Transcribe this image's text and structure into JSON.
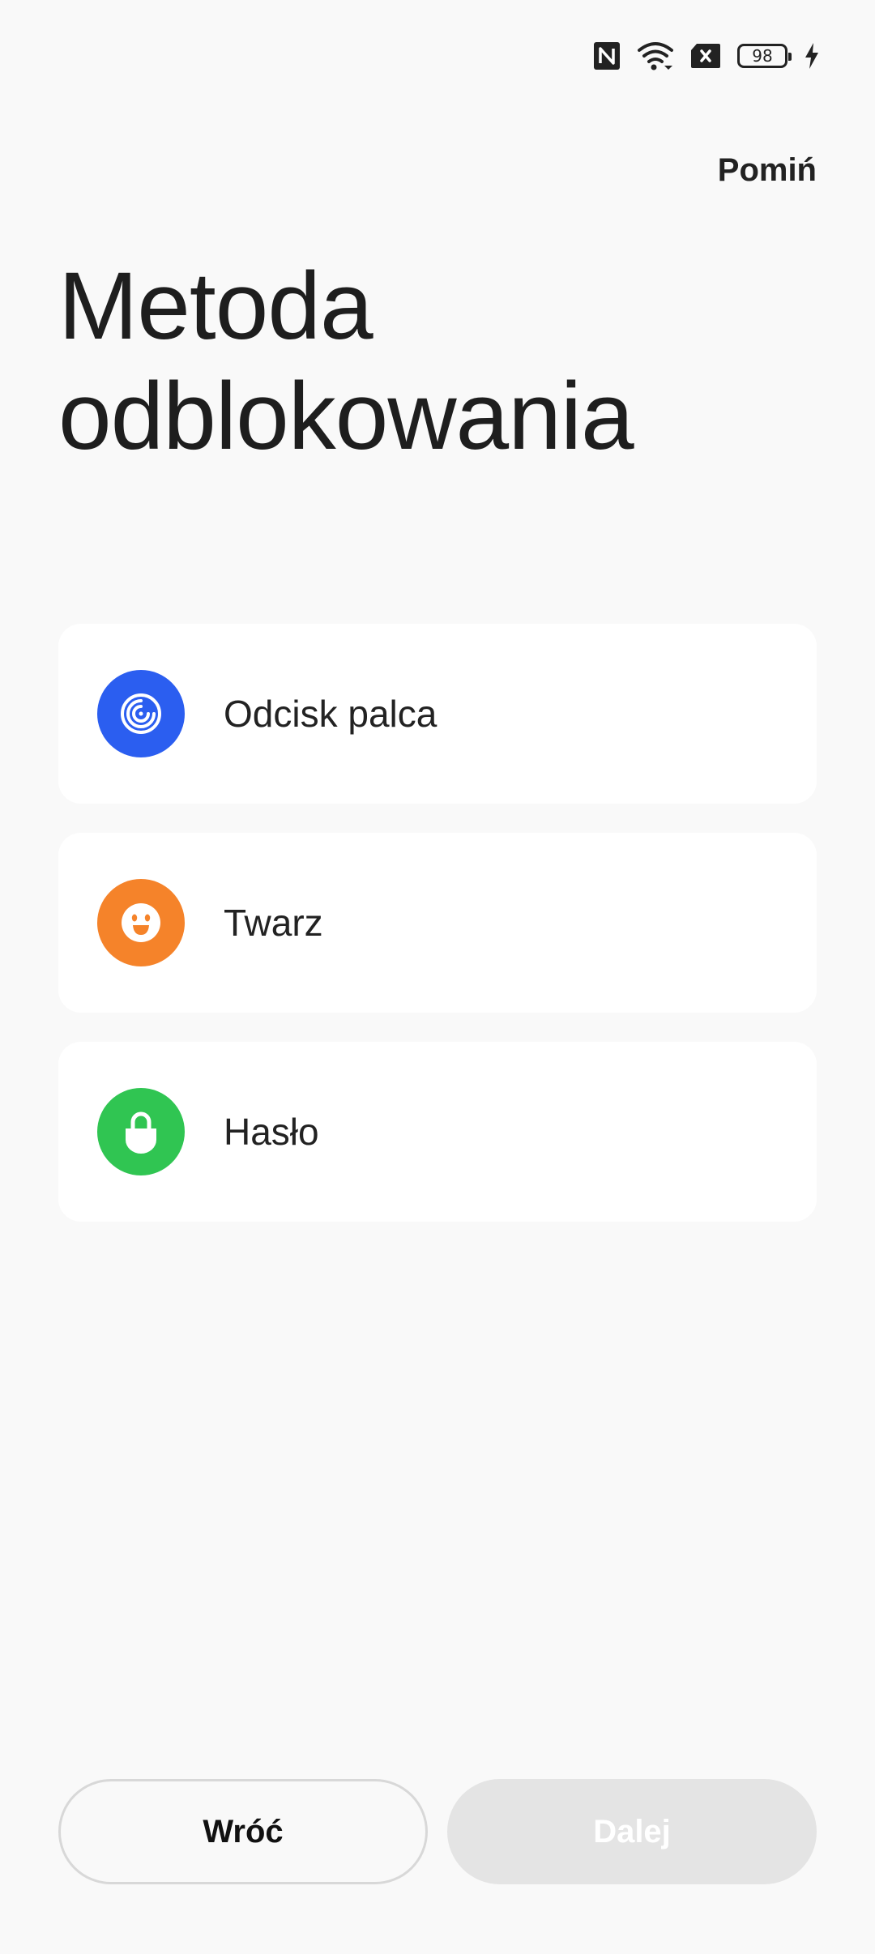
{
  "status_bar": {
    "icons": [
      "nfc-icon",
      "wifi-icon",
      "no-sim-icon",
      "battery-icon",
      "charging-icon"
    ],
    "battery_level": "98"
  },
  "header": {
    "skip_label": "Pomiń"
  },
  "main": {
    "title": "Metoda odblokowania",
    "options": [
      {
        "label": "Odcisk palca",
        "icon": "fingerprint-icon",
        "color": "#2b5ef0"
      },
      {
        "label": "Twarz",
        "icon": "face-icon",
        "color": "#f5832a"
      },
      {
        "label": "Hasło",
        "icon": "lock-icon",
        "color": "#30c552"
      }
    ]
  },
  "footer": {
    "back_label": "Wróć",
    "next_label": "Dalej"
  }
}
